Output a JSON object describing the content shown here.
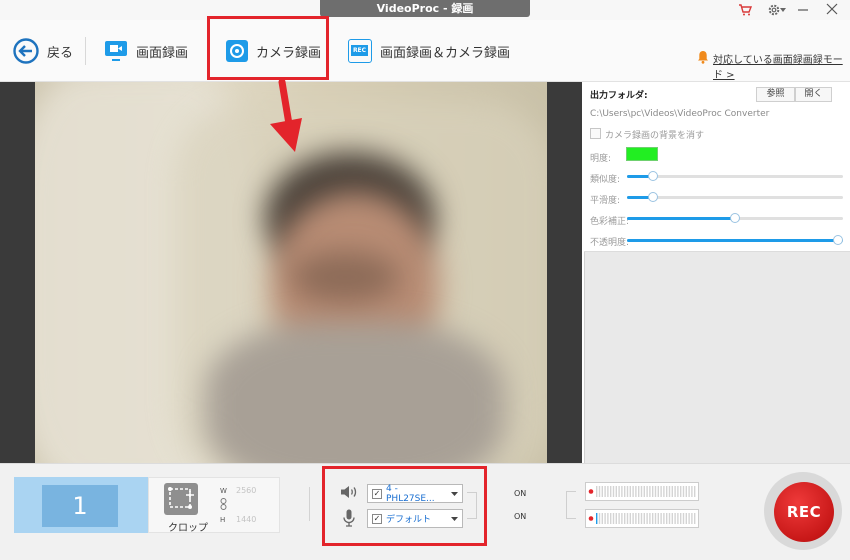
{
  "window": {
    "title": "VideoProc - 録画"
  },
  "toolbar": {
    "back_label": "戻る",
    "screen_record_label": "画面録画",
    "camera_record_label": "カメラ録画",
    "screen_camera_record_label": "画面録画＆カメラ録画",
    "rec_icon_text": "REC",
    "supported_modes_link": "対応している画面録画録モード >"
  },
  "settings": {
    "output_folder_label": "出力フォルダ:",
    "browse_label": "参照",
    "open_label": "開く",
    "output_path": "C:\\Users\\pc\\Videos\\VideoProc Converter",
    "remove_bg_label": "カメラ録画の背景を消す",
    "brightness_label": "明度:",
    "brightness_color": "#22ee22",
    "similarity_label": "類似度:",
    "similarity_value": 0.12,
    "smoothness_label": "平滑度:",
    "smoothness_value": 0.12,
    "color_correction_label": "色彩補正:",
    "color_correction_value": 0.5,
    "opacity_label": "不透明度:",
    "opacity_value": 1.0
  },
  "capture": {
    "monitor_number": "1",
    "crop_label": "クロップ",
    "w_label": "W",
    "w_value": "2560",
    "h_label": "H",
    "h_value": "1440"
  },
  "audio": {
    "speaker_device": "4 - PHL27SE...",
    "mic_device": "デフォルト",
    "speaker_state": "ON",
    "mic_state": "ON",
    "speaker_level": 0.0,
    "mic_level": 0.04
  },
  "rec_button_label": "REC",
  "colors": {
    "accent": "#1e9be8",
    "highlight": "#e3242b",
    "rec": "#d01c1c"
  }
}
